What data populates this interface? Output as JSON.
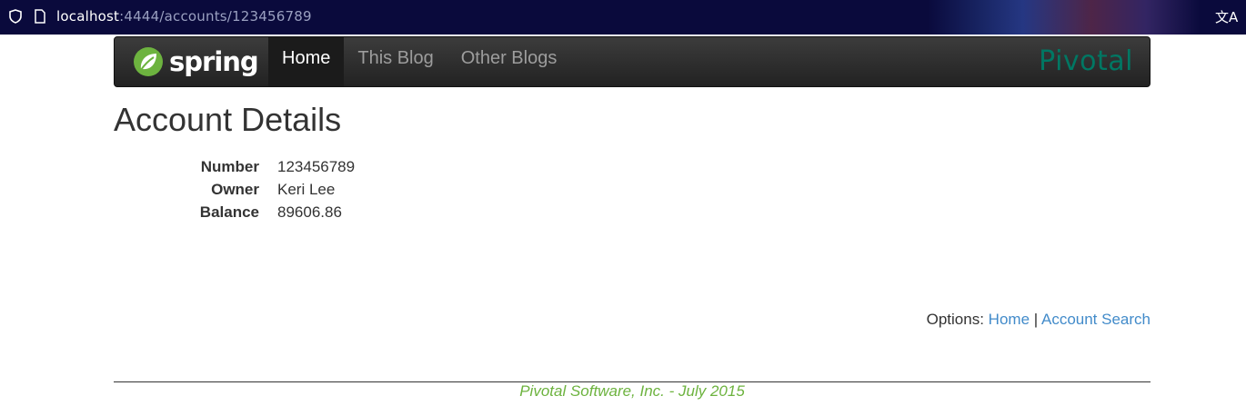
{
  "browser": {
    "url_host": "localhost",
    "url_rest": ":4444/accounts/123456789"
  },
  "navbar": {
    "brand": "spring",
    "items": [
      {
        "label": "Home",
        "active": true
      },
      {
        "label": "This Blog",
        "active": false
      },
      {
        "label": "Other Blogs",
        "active": false
      }
    ],
    "partner": "Pivotal"
  },
  "page": {
    "title": "Account Details"
  },
  "account": {
    "number_label": "Number",
    "number": "123456789",
    "owner_label": "Owner",
    "owner": "Keri Lee",
    "balance_label": "Balance",
    "balance": "89606.86"
  },
  "options": {
    "label": "Options:",
    "home": "Home",
    "separator": "|",
    "search": "Account Search"
  },
  "footer": {
    "text": "Pivotal Software, Inc. - July 2015"
  },
  "colors": {
    "spring_green": "#6db33f",
    "pivotal_teal": "#007763",
    "link_blue": "#428bca"
  }
}
